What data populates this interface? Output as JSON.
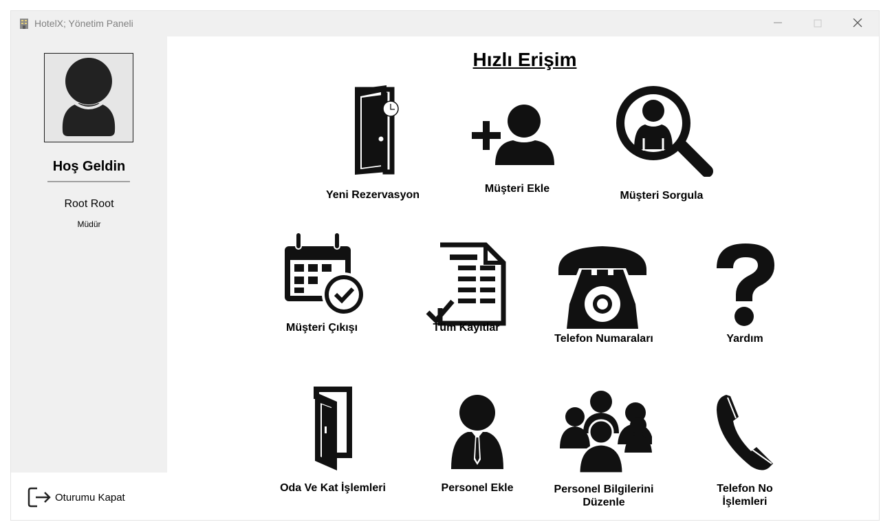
{
  "window": {
    "title": "HotelX; Yönetim Paneli",
    "icon": "hotel-building-icon",
    "controls": [
      "minimize-icon",
      "maximize-icon",
      "close-icon"
    ]
  },
  "sidebar": {
    "avatar_icon": "user-avatar-icon",
    "welcome": "Hoş Geldin",
    "user_name": "Root Root",
    "user_role": "Müdür",
    "logout_label": "Oturumu Kapat",
    "logout_icon": "logout-icon"
  },
  "main": {
    "title": "Hızlı Erişim",
    "tiles": [
      {
        "label": "Yeni Rezervasyon",
        "icon": "door-clock-icon"
      },
      {
        "label": "Müşteri Ekle",
        "icon": "add-user-icon"
      },
      {
        "label": "Müşteri Sorgula",
        "icon": "search-user-icon"
      },
      {
        "label": "Müşteri Çıkışı",
        "icon": "calendar-check-icon"
      },
      {
        "label": "Tüm Kayıtlar",
        "icon": "document-list-icon"
      },
      {
        "label": "Telefon Numaraları",
        "icon": "rotary-phone-icon"
      },
      {
        "label": "Yardım",
        "icon": "question-mark-icon"
      },
      {
        "label": "Oda Ve Kat İşlemleri",
        "icon": "door-icon"
      },
      {
        "label": "Personel Ekle",
        "icon": "staff-icon"
      },
      {
        "label": "Personel Bilgilerini",
        "label2": "Düzenle",
        "icon": "group-icon"
      },
      {
        "label": "Telefon No",
        "label2": "İşlemleri",
        "icon": "phone-handset-icon"
      }
    ]
  },
  "colors": {
    "sidebar_bg": "#f0f0f0",
    "titlebar_bg": "#f0f0f0",
    "icon_fill": "#111111",
    "text": "#000000"
  }
}
